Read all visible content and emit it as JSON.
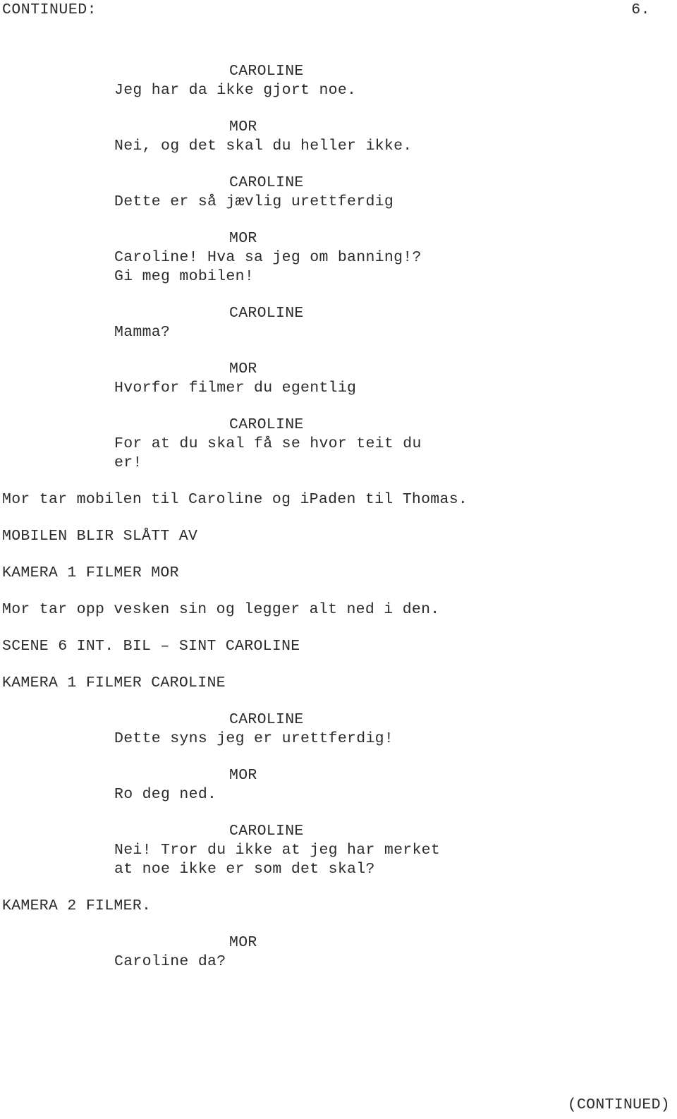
{
  "document": {
    "type": "screenplay-page",
    "language": "Norwegian",
    "header": {
      "continued_label": "CONTINUED:",
      "page_number": "6."
    },
    "footer": {
      "continued_label": "(CONTINUED)"
    }
  },
  "script": {
    "blocks": [
      {
        "kind": "dialogue",
        "cue": "CAROLINE",
        "lines": [
          "Jeg har da ikke gjort noe."
        ]
      },
      {
        "kind": "dialogue",
        "cue": "MOR",
        "lines": [
          "Nei, og det skal du heller ikke."
        ]
      },
      {
        "kind": "dialogue",
        "cue": "CAROLINE",
        "lines": [
          "Dette er så jævlig urettferdig"
        ]
      },
      {
        "kind": "dialogue",
        "cue": "MOR",
        "lines": [
          "Caroline! Hva sa jeg om banning!?",
          "Gi meg mobilen!"
        ]
      },
      {
        "kind": "dialogue",
        "cue": "CAROLINE",
        "lines": [
          "Mamma?"
        ]
      },
      {
        "kind": "dialogue",
        "cue": "MOR",
        "lines": [
          "Hvorfor filmer du egentlig"
        ]
      },
      {
        "kind": "dialogue",
        "cue": "CAROLINE",
        "lines": [
          "For at du skal få se hvor teit du",
          "er!"
        ]
      },
      {
        "kind": "action",
        "lines": [
          "Mor tar mobilen til Caroline og iPaden til Thomas."
        ]
      },
      {
        "kind": "action",
        "lines": [
          "MOBILEN BLIR SLÅTT AV"
        ]
      },
      {
        "kind": "action",
        "lines": [
          "KAMERA 1 FILMER MOR"
        ]
      },
      {
        "kind": "action",
        "lines": [
          "Mor tar opp vesken sin og legger alt ned i den."
        ]
      },
      {
        "kind": "scene-heading",
        "lines": [
          "SCENE 6 INT. BIL – SINT CAROLINE"
        ]
      },
      {
        "kind": "action",
        "lines": [
          "KAMERA 1 FILMER CAROLINE"
        ]
      },
      {
        "kind": "dialogue",
        "cue": "CAROLINE",
        "lines": [
          "Dette syns jeg er urettferdig!"
        ]
      },
      {
        "kind": "dialogue",
        "cue": "MOR",
        "lines": [
          "Ro deg ned."
        ]
      },
      {
        "kind": "dialogue",
        "cue": "CAROLINE",
        "lines": [
          "Nei! Tror du ikke at jeg har merket",
          "at noe ikke er som det skal?"
        ]
      },
      {
        "kind": "action",
        "lines": [
          "KAMERA 2 FILMER."
        ]
      },
      {
        "kind": "dialogue",
        "cue": "MOR",
        "lines": [
          "Caroline da?"
        ]
      }
    ]
  }
}
